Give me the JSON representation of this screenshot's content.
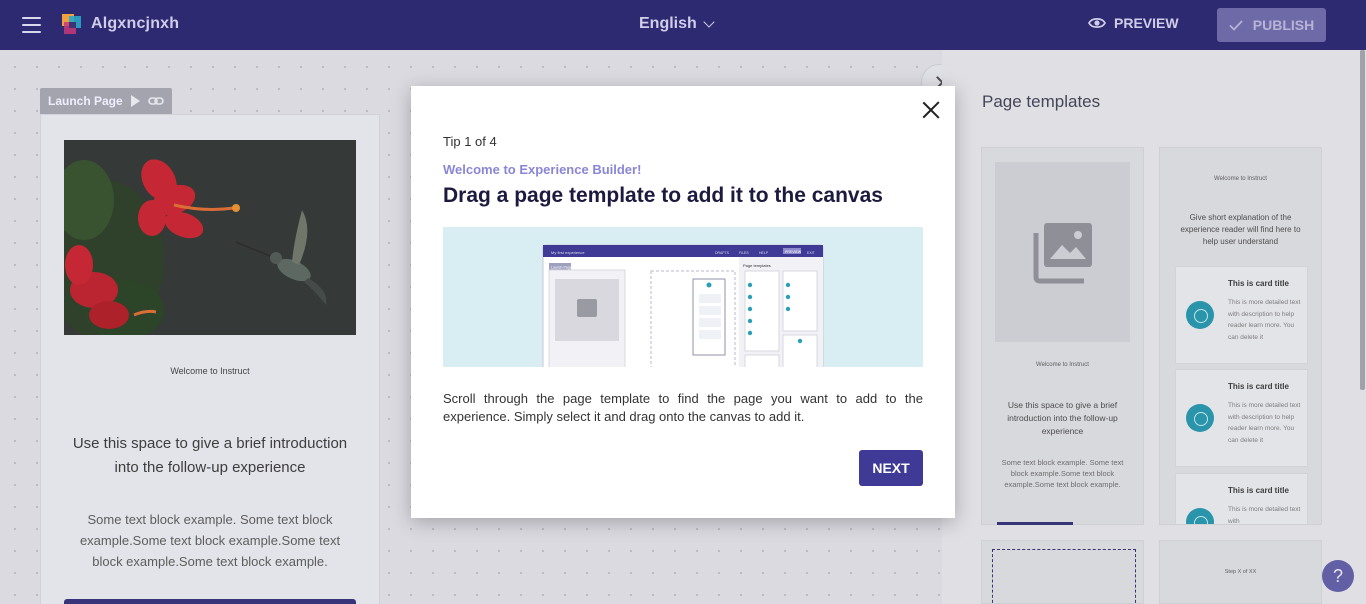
{
  "topbar": {
    "app_name": "Algxncjnxh",
    "language": "English",
    "preview_label": "PREVIEW",
    "publish_label": "PUBLISH",
    "colors": {
      "bar": "#2e2a72",
      "publish_disabled": "#6e6aa8"
    }
  },
  "canvas": {
    "launch_label": "Launch Page",
    "welcome_text": "Welcome to Instruct",
    "intro_heading": "Use this space to give a brief introduction into the follow-up experience",
    "intro_body": "Some text block example. Some text block example.Some text block example.Some text block example.Some text block example."
  },
  "panel": {
    "title": "Page templates",
    "template1": {
      "welcome": "Welcome to Instruct",
      "heading": "Use this space to give a brief introduction into the follow-up experience",
      "body": "Some text block example. Some text block example.Some text block example.Some text block example."
    },
    "template2": {
      "welcome": "Welcome to Instruct",
      "heading": "Give short explanation of the experience reader will find here to help user understand",
      "cards": [
        {
          "title": "This is card title",
          "body": "This is more detailed text with description to help reader learn more. You can delete it"
        },
        {
          "title": "This is card title",
          "body": "This is more detailed text with description to help reader learn more. You can delete it"
        },
        {
          "title": "This is card title",
          "body": "This is more detailed text with"
        }
      ]
    },
    "template4": {
      "step": "Step X of XX"
    }
  },
  "modal": {
    "tip_count": "Tip 1 of 4",
    "subtitle": "Welcome to Experience Builder!",
    "title": "Drag a page template to add it to the canvas",
    "body": "Scroll through the page template to find the page you want to add to the experience. Simply select it and drag onto the canvas to add it.",
    "next_label": "NEXT",
    "illustration": {
      "crumb": "My first experience",
      "menu": [
        "DRAFTS",
        "FILES",
        "HELP",
        "PREVIEW",
        "EXIT"
      ],
      "tag": "Launch Page",
      "panel_title": "Page templates"
    }
  },
  "help": {
    "label": "?"
  }
}
